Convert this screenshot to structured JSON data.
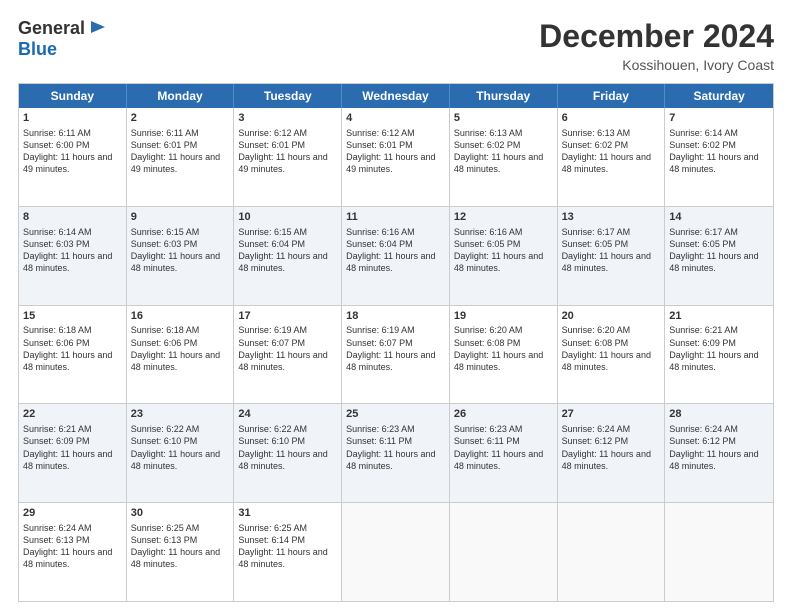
{
  "header": {
    "logo_general": "General",
    "logo_blue": "Blue",
    "month_title": "December 2024",
    "location": "Kossihouen, Ivory Coast"
  },
  "calendar": {
    "days": [
      "Sunday",
      "Monday",
      "Tuesday",
      "Wednesday",
      "Thursday",
      "Friday",
      "Saturday"
    ],
    "rows": [
      [
        {
          "num": "1",
          "sunrise": "6:11 AM",
          "sunset": "6:00 PM",
          "daylight": "11 hours and 49 minutes."
        },
        {
          "num": "2",
          "sunrise": "6:11 AM",
          "sunset": "6:01 PM",
          "daylight": "11 hours and 49 minutes."
        },
        {
          "num": "3",
          "sunrise": "6:12 AM",
          "sunset": "6:01 PM",
          "daylight": "11 hours and 49 minutes."
        },
        {
          "num": "4",
          "sunrise": "6:12 AM",
          "sunset": "6:01 PM",
          "daylight": "11 hours and 49 minutes."
        },
        {
          "num": "5",
          "sunrise": "6:13 AM",
          "sunset": "6:02 PM",
          "daylight": "11 hours and 48 minutes."
        },
        {
          "num": "6",
          "sunrise": "6:13 AM",
          "sunset": "6:02 PM",
          "daylight": "11 hours and 48 minutes."
        },
        {
          "num": "7",
          "sunrise": "6:14 AM",
          "sunset": "6:02 PM",
          "daylight": "11 hours and 48 minutes."
        }
      ],
      [
        {
          "num": "8",
          "sunrise": "6:14 AM",
          "sunset": "6:03 PM",
          "daylight": "11 hours and 48 minutes."
        },
        {
          "num": "9",
          "sunrise": "6:15 AM",
          "sunset": "6:03 PM",
          "daylight": "11 hours and 48 minutes."
        },
        {
          "num": "10",
          "sunrise": "6:15 AM",
          "sunset": "6:04 PM",
          "daylight": "11 hours and 48 minutes."
        },
        {
          "num": "11",
          "sunrise": "6:16 AM",
          "sunset": "6:04 PM",
          "daylight": "11 hours and 48 minutes."
        },
        {
          "num": "12",
          "sunrise": "6:16 AM",
          "sunset": "6:05 PM",
          "daylight": "11 hours and 48 minutes."
        },
        {
          "num": "13",
          "sunrise": "6:17 AM",
          "sunset": "6:05 PM",
          "daylight": "11 hours and 48 minutes."
        },
        {
          "num": "14",
          "sunrise": "6:17 AM",
          "sunset": "6:05 PM",
          "daylight": "11 hours and 48 minutes."
        }
      ],
      [
        {
          "num": "15",
          "sunrise": "6:18 AM",
          "sunset": "6:06 PM",
          "daylight": "11 hours and 48 minutes."
        },
        {
          "num": "16",
          "sunrise": "6:18 AM",
          "sunset": "6:06 PM",
          "daylight": "11 hours and 48 minutes."
        },
        {
          "num": "17",
          "sunrise": "6:19 AM",
          "sunset": "6:07 PM",
          "daylight": "11 hours and 48 minutes."
        },
        {
          "num": "18",
          "sunrise": "6:19 AM",
          "sunset": "6:07 PM",
          "daylight": "11 hours and 48 minutes."
        },
        {
          "num": "19",
          "sunrise": "6:20 AM",
          "sunset": "6:08 PM",
          "daylight": "11 hours and 48 minutes."
        },
        {
          "num": "20",
          "sunrise": "6:20 AM",
          "sunset": "6:08 PM",
          "daylight": "11 hours and 48 minutes."
        },
        {
          "num": "21",
          "sunrise": "6:21 AM",
          "sunset": "6:09 PM",
          "daylight": "11 hours and 48 minutes."
        }
      ],
      [
        {
          "num": "22",
          "sunrise": "6:21 AM",
          "sunset": "6:09 PM",
          "daylight": "11 hours and 48 minutes."
        },
        {
          "num": "23",
          "sunrise": "6:22 AM",
          "sunset": "6:10 PM",
          "daylight": "11 hours and 48 minutes."
        },
        {
          "num": "24",
          "sunrise": "6:22 AM",
          "sunset": "6:10 PM",
          "daylight": "11 hours and 48 minutes."
        },
        {
          "num": "25",
          "sunrise": "6:23 AM",
          "sunset": "6:11 PM",
          "daylight": "11 hours and 48 minutes."
        },
        {
          "num": "26",
          "sunrise": "6:23 AM",
          "sunset": "6:11 PM",
          "daylight": "11 hours and 48 minutes."
        },
        {
          "num": "27",
          "sunrise": "6:24 AM",
          "sunset": "6:12 PM",
          "daylight": "11 hours and 48 minutes."
        },
        {
          "num": "28",
          "sunrise": "6:24 AM",
          "sunset": "6:12 PM",
          "daylight": "11 hours and 48 minutes."
        }
      ],
      [
        {
          "num": "29",
          "sunrise": "6:24 AM",
          "sunset": "6:13 PM",
          "daylight": "11 hours and 48 minutes."
        },
        {
          "num": "30",
          "sunrise": "6:25 AM",
          "sunset": "6:13 PM",
          "daylight": "11 hours and 48 minutes."
        },
        {
          "num": "31",
          "sunrise": "6:25 AM",
          "sunset": "6:14 PM",
          "daylight": "11 hours and 48 minutes."
        },
        null,
        null,
        null,
        null
      ]
    ]
  }
}
